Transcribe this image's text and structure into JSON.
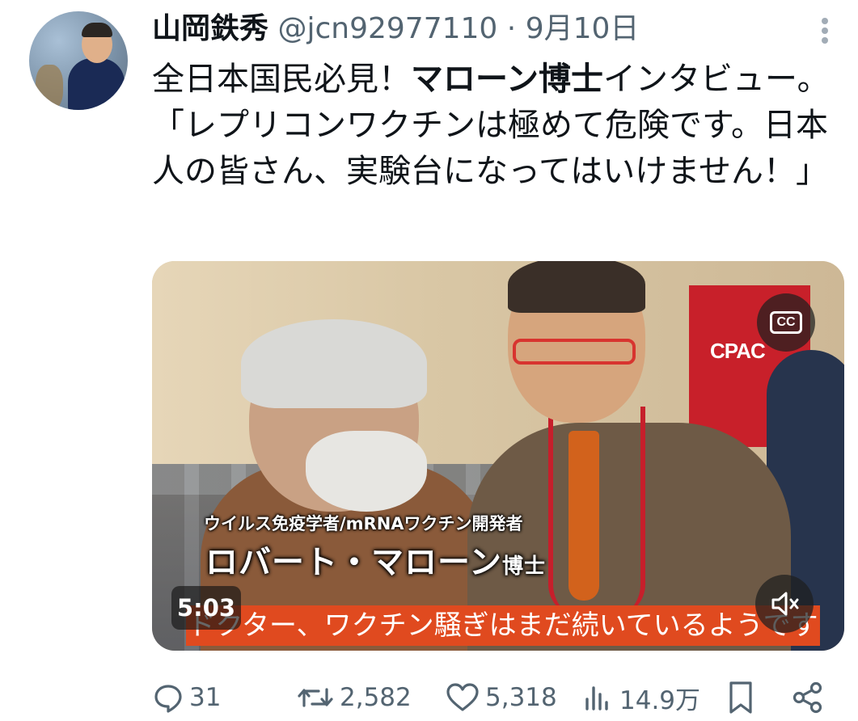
{
  "tweet": {
    "author_name": "山岡鉄秀",
    "handle": "@jcn92977110",
    "separator": "·",
    "date": "9月10日",
    "text_parts": [
      {
        "text": "全日本国民必見！",
        "bold": false
      },
      {
        "text": "マローン博士",
        "bold": true
      },
      {
        "text": "インタビュー。「レプリコンワクチンは極めて危険です。日本人の皆さん、実験台になってはいけません！」",
        "bold": false
      }
    ]
  },
  "video": {
    "banner_text": "CPAC",
    "caption_top": "ウイルス免疫学者/mRNAワクチン開発者",
    "caption_name": "ロバート・マローン",
    "caption_suffix": "博士",
    "subtitle": "ドクター、ワクチン騒ぎはまだ続いているようです",
    "duration": "5:03",
    "cc_label": "CC"
  },
  "actions": {
    "replies": "31",
    "reposts": "2,582",
    "likes": "5,318",
    "views": "14.9万"
  },
  "colors": {
    "text": "#0f1419",
    "muted": "#536471",
    "subtitle_bg": "#e04a1f",
    "banner": "#c8202a"
  }
}
